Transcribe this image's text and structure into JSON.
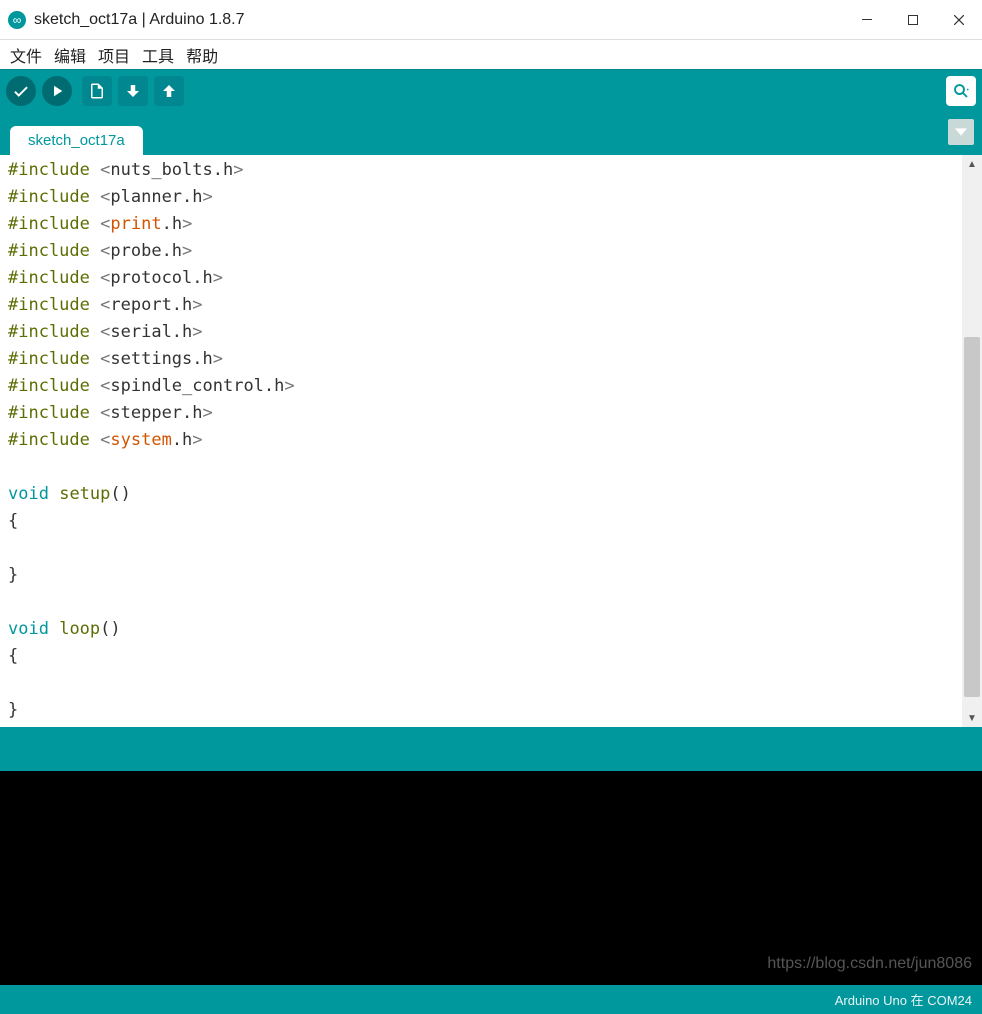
{
  "window": {
    "title": "sketch_oct17a | Arduino 1.8.7"
  },
  "menu": {
    "items": [
      "文件",
      "编辑",
      "项目",
      "工具",
      "帮助"
    ]
  },
  "toolbar": {
    "verify": "Verify",
    "upload": "Upload",
    "new": "New",
    "open": "Open",
    "save": "Save",
    "serial": "Serial Monitor"
  },
  "tabs": {
    "active": "sketch_oct17a"
  },
  "code": {
    "lines": [
      {
        "type": "include",
        "header": "nuts_bolts.h",
        "special": false
      },
      {
        "type": "include",
        "header": "planner.h",
        "special": false
      },
      {
        "type": "include",
        "header": "print.h",
        "special": "print"
      },
      {
        "type": "include",
        "header": "probe.h",
        "special": false
      },
      {
        "type": "include",
        "header": "protocol.h",
        "special": false
      },
      {
        "type": "include",
        "header": "report.h",
        "special": false
      },
      {
        "type": "include",
        "header": "serial.h",
        "special": false
      },
      {
        "type": "include",
        "header": "settings.h",
        "special": false
      },
      {
        "type": "include",
        "header": "spindle_control.h",
        "special": false
      },
      {
        "type": "include",
        "header": "stepper.h",
        "special": false
      },
      {
        "type": "include",
        "header": "system.h",
        "special": "system"
      },
      {
        "type": "blank"
      },
      {
        "type": "func-decl",
        "ret": "void",
        "name": "setup"
      },
      {
        "type": "brace-open"
      },
      {
        "type": "blank"
      },
      {
        "type": "brace-close"
      },
      {
        "type": "blank"
      },
      {
        "type": "func-decl",
        "ret": "void",
        "name": "loop"
      },
      {
        "type": "brace-open"
      },
      {
        "type": "blank"
      },
      {
        "type": "brace-close"
      }
    ]
  },
  "footer": {
    "board": "Arduino Uno 在 COM24"
  },
  "watermark": "https://blog.csdn.net/jun8086"
}
